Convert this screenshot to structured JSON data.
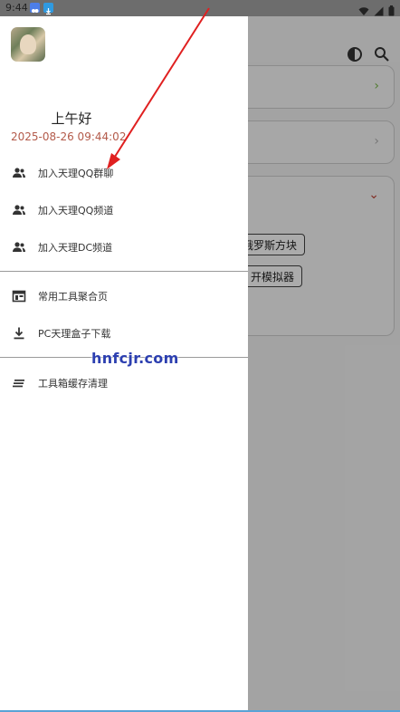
{
  "status_bar": {
    "time": "9:44",
    "icons": [
      "app-notification-icon",
      "download-icon",
      "wifi-icon",
      "signal-icon",
      "battery-icon"
    ]
  },
  "background": {
    "topbar_icons": [
      "theme-toggle-icon",
      "search-icon"
    ],
    "button_1_label": "俄罗斯方块",
    "button_2_label": "开模拟器"
  },
  "drawer": {
    "greeting": "上午好",
    "datetime": "2025-08-26 09:44:02",
    "section_1": [
      {
        "label": "加入天理QQ群聊",
        "icon": "group-add-icon"
      },
      {
        "label": "加入天理QQ频道",
        "icon": "group-icon"
      },
      {
        "label": "加入天理DC频道",
        "icon": "group-icon"
      }
    ],
    "section_2": [
      {
        "label": "常用工具聚合页",
        "icon": "dashboard-icon"
      },
      {
        "label": "PC天理盒子下载",
        "icon": "download-icon"
      }
    ],
    "section_3": [
      {
        "label": "工具箱缓存清理",
        "icon": "clear-list-icon"
      }
    ]
  },
  "watermark": "hnfcjr.com",
  "colors": {
    "accent_date": "#b35a4a",
    "chevron_green": "#7ab84a",
    "chevron_red": "#c0463a",
    "annotation_arrow": "#e02020",
    "watermark": "#2c3fb0"
  }
}
